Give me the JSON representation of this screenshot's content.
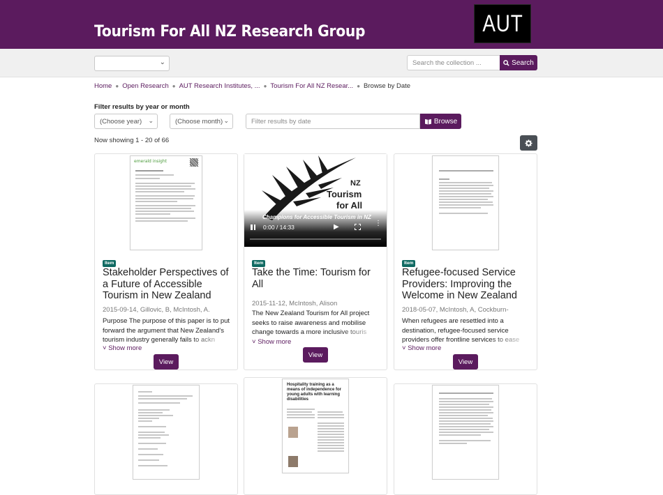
{
  "header": {
    "site_title": "Tourism For All NZ Research Group",
    "logo_text": "AUT"
  },
  "search": {
    "scope_value": "",
    "placeholder": "Search the collection ...",
    "button_label": "Search"
  },
  "breadcrumb": {
    "items": [
      "Home",
      "Open Research",
      "AUT Research Institutes, ...",
      "Tourism For All NZ Resear..."
    ],
    "current": "Browse by Date"
  },
  "filter": {
    "label": "Filter results by year or month",
    "year_placeholder": "(Choose year)",
    "month_placeholder": "(Choose month)",
    "date_placeholder": "Filter results by date",
    "browse_label": "Browse"
  },
  "results": {
    "showing": "Now showing 1 - 20 of 66"
  },
  "cards": [
    {
      "badge": "Item",
      "title": "Stakeholder Perspectives of a Future of Accessible Tourism in New Zealand",
      "meta": "2015-09-14, Gillovic, B, McIntosh, A.",
      "abstract": "Purpose The purpose of this paper is to put forward the argument that New Zealand's tourism industry generally fails to ackn",
      "show_more": "Show more",
      "view": "View",
      "thumb_brand": "emerald insight"
    },
    {
      "badge": "Item",
      "title": "Take the Time: Tourism for All",
      "meta": "2015-11-12, McIntosh, Alison",
      "abstract": "The New Zealand Tourism for All project seeks to raise awareness and mobilise change towards a more inclusive touris",
      "show_more": "Show more",
      "view": "View",
      "video": {
        "title_nz": "NZ",
        "title_main": "Tourism",
        "title_sub": "for All",
        "subtitle": "Champions for Accessible Tourism in NZ",
        "time": "0:00 / 14:33"
      }
    },
    {
      "badge": "Item",
      "title": "Refugee-focused Service Providers: Improving the Welcome in New Zealand",
      "meta": "2018-05-07, McIntosh, A, Cockburn-",
      "abstract": "When refugees are resettled into a destination, refugee-focused service providers offer frontline services to ease refugees' exp",
      "show_more": "Show more",
      "view": "View"
    },
    {
      "thumb_title": "Hospitality training as a means of independence for young adults with learning disabilities"
    }
  ],
  "colors": {
    "brand_purple": "#5b1b5e",
    "badge_teal": "#106a62",
    "gear_button": "#4a4f55"
  }
}
